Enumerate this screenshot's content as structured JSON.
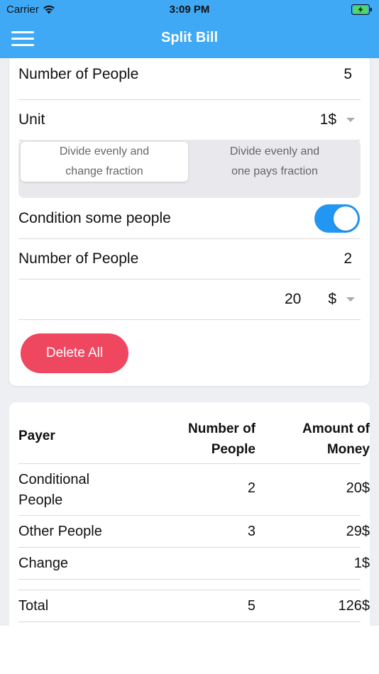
{
  "status_bar": {
    "carrier": "Carrier",
    "time": "3:09 PM"
  },
  "nav": {
    "title": "Split Bill",
    "menu_icon": "hamburger-menu-icon"
  },
  "form": {
    "people_label": "Number of People",
    "people_value": "5",
    "unit_label": "Unit",
    "unit_value": "1$",
    "segment_options": [
      {
        "line1": "Divide evenly and",
        "line2": "change fraction",
        "selected": true
      },
      {
        "line1": "Divide evenly and",
        "line2": "one pays fraction",
        "selected": false
      }
    ],
    "condition_label": "Condition some people",
    "condition_on": true,
    "cond_people_label": "Number of People",
    "cond_people_value": "2",
    "amount_value": "20",
    "amount_currency": "$",
    "delete_label": "Delete All"
  },
  "colors": {
    "header": "#3fa9f5",
    "toggle": "#2196f3",
    "delete": "#ef4760"
  },
  "table": {
    "headers": {
      "payer": "Payer",
      "people_line1": "Number of",
      "people_line2": "People",
      "money_line1": "Amount of",
      "money_line2": "Money"
    },
    "rows": [
      {
        "payer_line1": "Conditional",
        "payer_line2": "People",
        "people": "2",
        "amount": "20$"
      },
      {
        "payer": "Other People",
        "people": "3",
        "amount": "29$"
      },
      {
        "payer": "Change",
        "people": "",
        "amount": "1$"
      }
    ],
    "total": {
      "payer": "Total",
      "people": "5",
      "amount": "126$"
    }
  }
}
